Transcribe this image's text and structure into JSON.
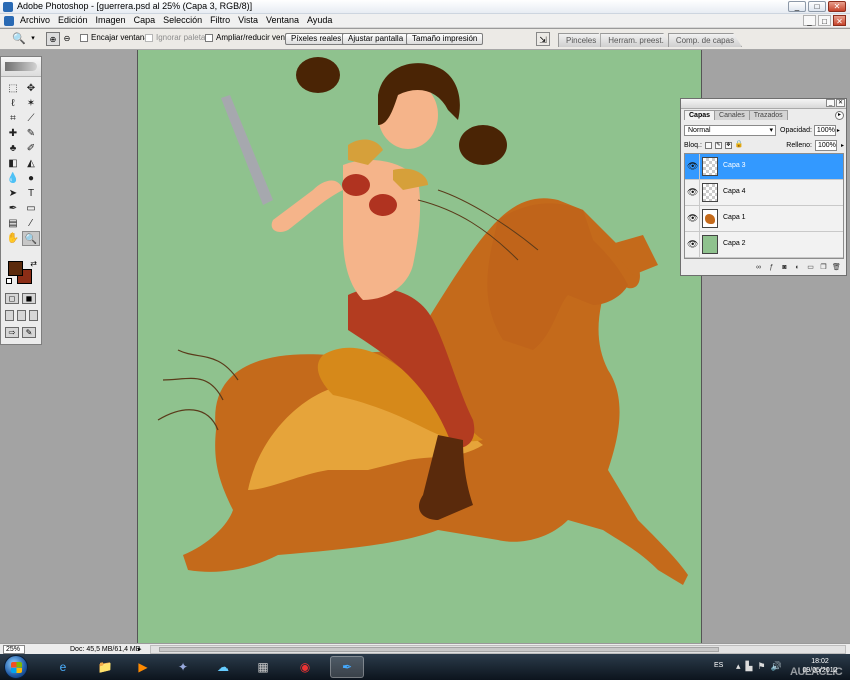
{
  "window": {
    "title": "Adobe Photoshop - [guerrera.psd al 25% (Capa 3, RGB/8)]",
    "controls": [
      "_",
      "□",
      "✕"
    ]
  },
  "menubar": {
    "items": [
      "Archivo",
      "Edición",
      "Imagen",
      "Capa",
      "Selección",
      "Filtro",
      "Vista",
      "Ventana",
      "Ayuda"
    ],
    "doc_controls": [
      "_",
      "□",
      "✕"
    ]
  },
  "options": {
    "tool_icon": "zoom-icon",
    "checkboxes": {
      "encajar": "Encajar ventana",
      "ignorar": "Ignorar paletas",
      "ampliar": "Ampliar/reducir vent."
    },
    "buttons": {
      "pixeles": "Píxeles reales",
      "ajustar": "Ajustar pantalla",
      "impresion": "Tamaño impresión"
    },
    "palette_well": [
      "Pinceles",
      "Herram. preest.",
      "Comp. de capas"
    ]
  },
  "toolbox": {
    "foreground_color": "#5b2a0c",
    "background_color": "#8b2d16"
  },
  "layers_panel": {
    "tabs": [
      "Capas",
      "Canales",
      "Trazados"
    ],
    "blend_mode": "Normal",
    "opacity_label": "Opacidad:",
    "opacity_value": "100%",
    "lock_label": "Bloq.:",
    "fill_label": "Relleno:",
    "fill_value": "100%",
    "layers": [
      {
        "name": "Capa 3",
        "selected": true,
        "thumb": "transparent"
      },
      {
        "name": "Capa 4",
        "selected": false,
        "thumb": "transparent"
      },
      {
        "name": "Capa 1",
        "selected": false,
        "thumb": "horse"
      },
      {
        "name": "Capa 2",
        "selected": false,
        "thumb": "green"
      }
    ]
  },
  "statusbar": {
    "zoom": "25%",
    "doc": "Doc: 45,5 MB/61,4 MB"
  },
  "taskbar": {
    "language": "ES",
    "time": "18:02",
    "date": "09/05/2012"
  },
  "watermark": "AULACLIC",
  "colors": {
    "canvas_bg": "#8fc28e",
    "horse": "#c46a1b",
    "selection": "#3399ff"
  }
}
